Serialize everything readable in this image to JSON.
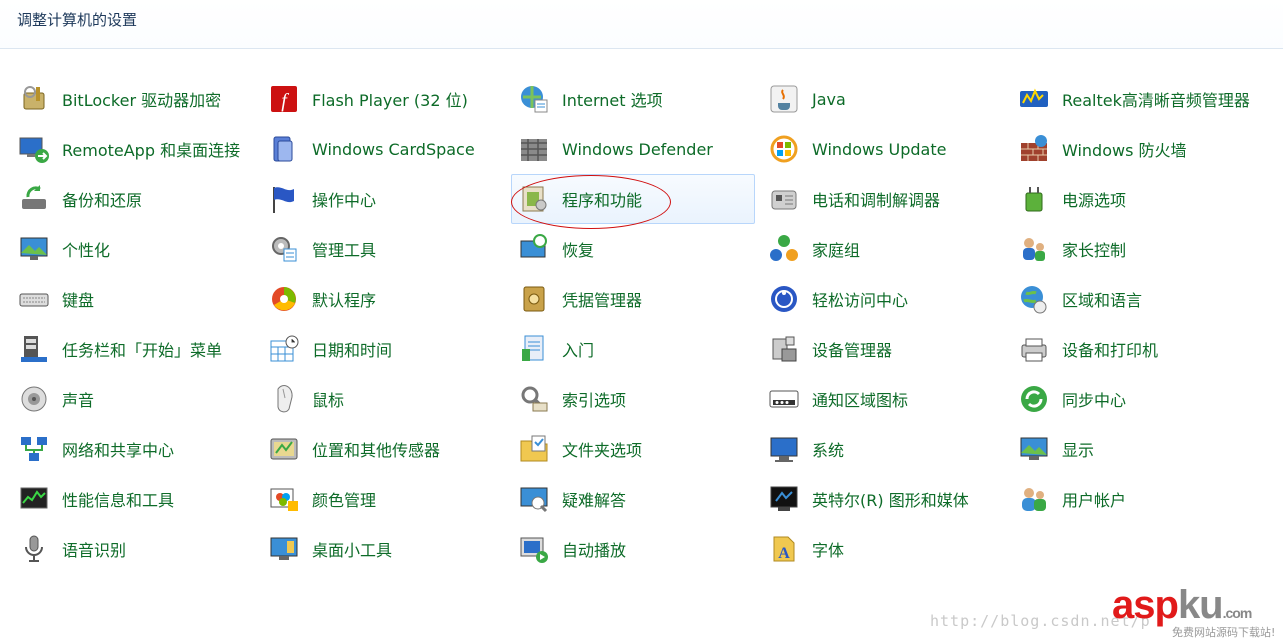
{
  "header": {
    "title": "调整计算机的设置"
  },
  "items": [
    {
      "label": "BitLocker 驱动器加密",
      "icon": "bitlocker-key-icon"
    },
    {
      "label": "Flash Player (32 位)",
      "icon": "flash-player-icon"
    },
    {
      "label": "Internet 选项",
      "icon": "internet-options-icon"
    },
    {
      "label": "Java",
      "icon": "java-icon"
    },
    {
      "label": "Realtek高清晰音频管理器",
      "icon": "realtek-audio-icon"
    },
    {
      "label": "RemoteApp 和桌面连接",
      "icon": "remoteapp-icon"
    },
    {
      "label": "Windows CardSpace",
      "icon": "cardspace-icon"
    },
    {
      "label": "Windows Defender",
      "icon": "defender-icon"
    },
    {
      "label": "Windows Update",
      "icon": "windows-update-icon"
    },
    {
      "label": "Windows 防火墙",
      "icon": "firewall-icon"
    },
    {
      "label": "备份和还原",
      "icon": "backup-restore-icon"
    },
    {
      "label": "操作中心",
      "icon": "action-center-flag-icon"
    },
    {
      "label": "程序和功能",
      "icon": "programs-features-icon"
    },
    {
      "label": "电话和调制解调器",
      "icon": "phone-modem-icon"
    },
    {
      "label": "电源选项",
      "icon": "power-options-icon"
    },
    {
      "label": "个性化",
      "icon": "personalization-icon"
    },
    {
      "label": "管理工具",
      "icon": "admin-tools-icon"
    },
    {
      "label": "恢复",
      "icon": "recovery-icon"
    },
    {
      "label": "家庭组",
      "icon": "homegroup-icon"
    },
    {
      "label": "家长控制",
      "icon": "parental-controls-icon"
    },
    {
      "label": "键盘",
      "icon": "keyboard-icon"
    },
    {
      "label": "默认程序",
      "icon": "default-programs-icon"
    },
    {
      "label": "凭据管理器",
      "icon": "credential-manager-icon"
    },
    {
      "label": "轻松访问中心",
      "icon": "ease-of-access-icon"
    },
    {
      "label": "区域和语言",
      "icon": "region-language-icon"
    },
    {
      "label": "任务栏和「开始」菜单",
      "icon": "taskbar-start-icon"
    },
    {
      "label": "日期和时间",
      "icon": "date-time-icon"
    },
    {
      "label": "入门",
      "icon": "getting-started-icon"
    },
    {
      "label": "设备管理器",
      "icon": "device-manager-icon"
    },
    {
      "label": "设备和打印机",
      "icon": "devices-printers-icon"
    },
    {
      "label": "声音",
      "icon": "sound-icon"
    },
    {
      "label": "鼠标",
      "icon": "mouse-icon"
    },
    {
      "label": "索引选项",
      "icon": "indexing-options-icon"
    },
    {
      "label": "通知区域图标",
      "icon": "notification-area-icon"
    },
    {
      "label": "同步中心",
      "icon": "sync-center-icon"
    },
    {
      "label": "网络和共享中心",
      "icon": "network-sharing-icon"
    },
    {
      "label": "位置和其他传感器",
      "icon": "location-sensors-icon"
    },
    {
      "label": "文件夹选项",
      "icon": "folder-options-icon"
    },
    {
      "label": "系统",
      "icon": "system-icon"
    },
    {
      "label": "显示",
      "icon": "display-icon"
    },
    {
      "label": "性能信息和工具",
      "icon": "performance-icon"
    },
    {
      "label": "颜色管理",
      "icon": "color-management-icon"
    },
    {
      "label": "疑难解答",
      "icon": "troubleshooting-icon"
    },
    {
      "label": "英特尔(R) 图形和媒体",
      "icon": "intel-graphics-icon"
    },
    {
      "label": "用户帐户",
      "icon": "user-accounts-icon"
    },
    {
      "label": "语音识别",
      "icon": "speech-recognition-icon"
    },
    {
      "label": "桌面小工具",
      "icon": "desktop-gadgets-icon"
    },
    {
      "label": "自动播放",
      "icon": "autoplay-icon"
    },
    {
      "label": "字体",
      "icon": "fonts-icon"
    }
  ],
  "highlighted_item": "程序和功能",
  "watermark": {
    "url": "http://blog.csdn.net/p",
    "logo_main": "asp",
    "logo_accent": "ku",
    "logo_suffix": ".com",
    "subtitle": "免费网站源码下载站!"
  },
  "colors": {
    "label": "#0d6b28",
    "header_title": "#1e395b",
    "highlight_border": "#b8d6fb",
    "annotation_oval": "#d01010"
  }
}
